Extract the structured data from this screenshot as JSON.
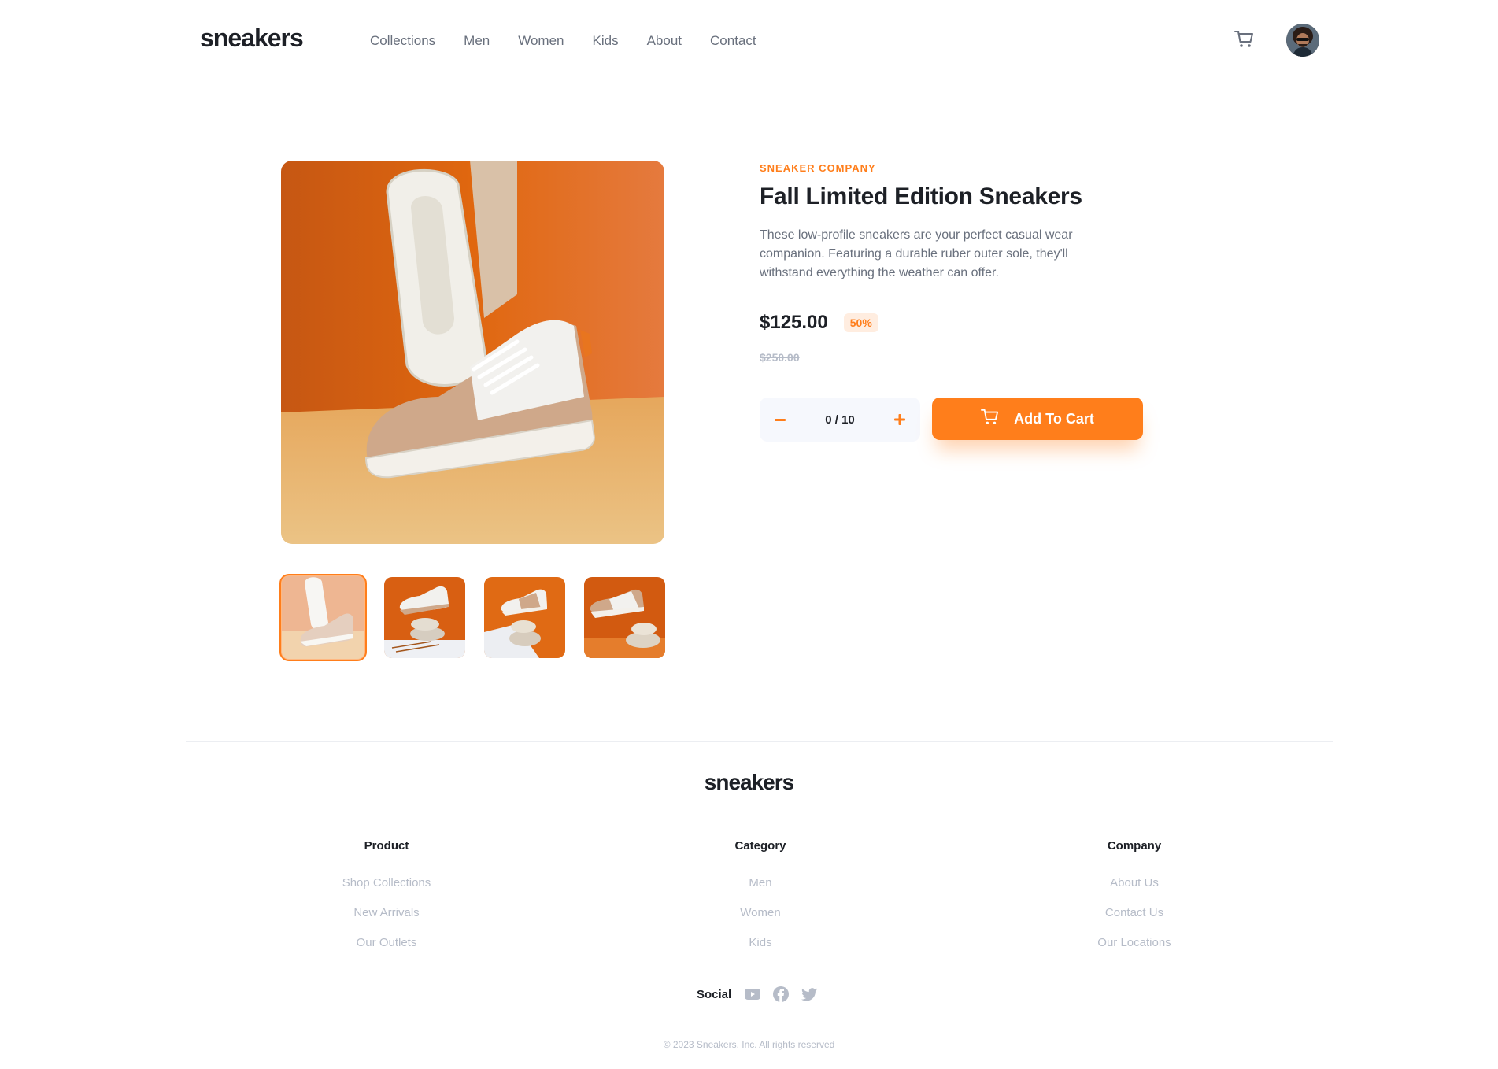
{
  "header": {
    "logo": "sneakers",
    "nav": [
      "Collections",
      "Men",
      "Women",
      "Kids",
      "About",
      "Contact"
    ],
    "cart_icon": "cart-icon",
    "avatar_icon": "user-avatar"
  },
  "product": {
    "company": "SNEAKER COMPANY",
    "title": "Fall Limited Edition Sneakers",
    "description": "These low-profile sneakers are your perfect casual wear companion. Featuring a durable ruber outer sole, they'll withstand everything the weather can offer.",
    "price": "$125.00",
    "discount": "50%",
    "old_price": "$250.00",
    "quantity": "0 / 10",
    "add_to_cart": "Add To Cart",
    "selected_thumbnail": 1
  },
  "colors": {
    "accent": "#ff7e1b",
    "accent_light": "#ffede0",
    "text_dark": "#1d2026",
    "text_muted": "#69707d",
    "text_light": "#b6bcc8"
  },
  "footer": {
    "logo": "sneakers",
    "columns": [
      {
        "heading": "Product",
        "links": [
          "Shop Collections",
          "New Arrivals",
          "Our Outlets"
        ]
      },
      {
        "heading": "Category",
        "links": [
          "Men",
          "Women",
          "Kids"
        ]
      },
      {
        "heading": "Company",
        "links": [
          "About Us",
          "Contact Us",
          "Our Locations"
        ]
      }
    ],
    "social_label": "Social",
    "social_icons": [
      "youtube-icon",
      "facebook-icon",
      "twitter-icon"
    ],
    "copyright": "© 2023 Sneakers, Inc. All rights reserved"
  }
}
